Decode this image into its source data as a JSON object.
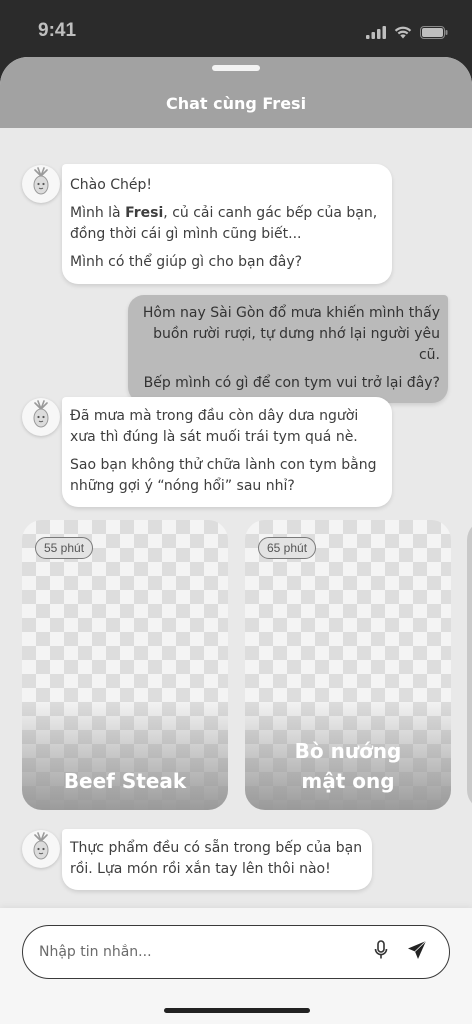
{
  "status_bar": {
    "time": "9:41"
  },
  "header": {
    "title": "Chat cùng Fresi"
  },
  "messages": [
    {
      "side": "bot",
      "paragraphs": [
        "Chào Chép!",
        "Mình là Fresi, củ cải canh gác bếp của bạn, đồng thời cái gì mình cũng biết...",
        "Mình có thể giúp gì cho bạn đây?"
      ]
    },
    {
      "side": "user",
      "paragraphs": [
        "Hôm nay Sài Gòn đổ mưa khiến mình thấy buồn rười rượi, tự dưng nhớ lại người yêu cũ.",
        "Bếp mình có gì để con tym vui trở lại đây?"
      ]
    },
    {
      "side": "bot",
      "paragraphs": [
        "Đã mưa mà trong đầu còn dây dưa người xưa thì đúng là sát muối trái tym quá nè.",
        "Sao bạn không thử chữa lành con tym bằng những gợi ý “nóng hổi” sau nhỉ?"
      ]
    },
    {
      "side": "bot",
      "paragraphs": [
        "Thực phẩm đều có sẵn trong bếp của bạn rồi. Lựa món rồi xắn tay lên thôi nào!"
      ]
    }
  ],
  "greeting": {
    "hello": "Chào Chép!",
    "intro_prefix": "Mình là ",
    "intro_name": "Fresi",
    "intro_suffix": ", củ cải canh gác bếp của bạn, đồng thời cái gì mình cũng biết...",
    "ask": "Mình có thể giúp gì cho bạn đây?"
  },
  "recipes": [
    {
      "time": "55 phút",
      "name": "Beef Steak"
    },
    {
      "time": "65 phút",
      "name": "Bò nướng mật ong"
    }
  ],
  "input": {
    "placeholder": "Nhập tin nhắn..."
  },
  "icons": {
    "mic": "microphone-icon",
    "send": "send-icon",
    "avatar": "radish-mascot-icon"
  }
}
